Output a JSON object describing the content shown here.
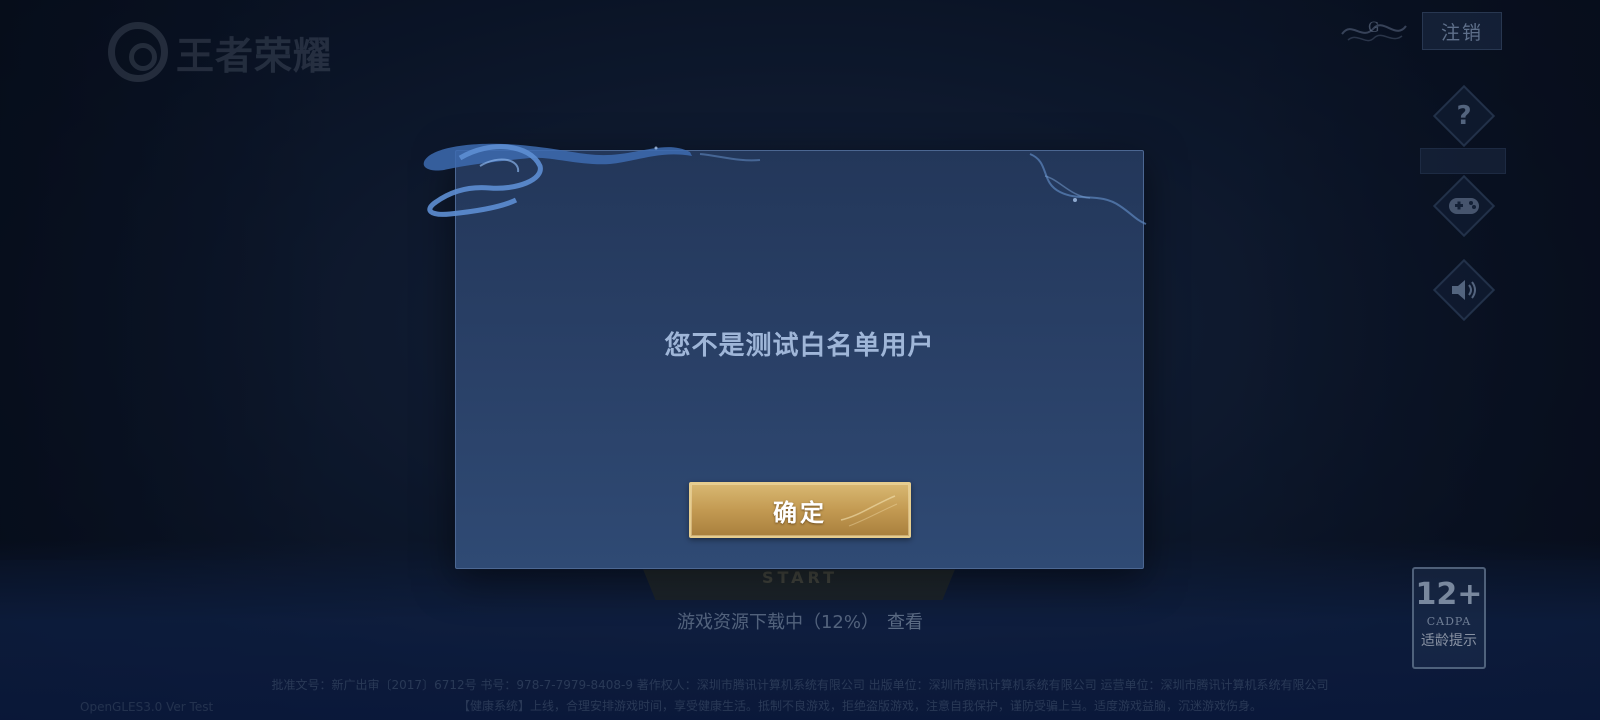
{
  "app": {
    "logo_text": "王者荣耀"
  },
  "top_right": {
    "logout_label": "注销",
    "help_icon": "question-icon",
    "gamepad_icon": "gamepad-icon",
    "sound_icon": "speaker-icon"
  },
  "dialog": {
    "message": "您不是测试白名单用户",
    "confirm_label": "确定"
  },
  "launcher": {
    "start_label": "START",
    "download_status": "游戏资源下载中（12%）",
    "download_progress_percent": 12,
    "view_link": "查看"
  },
  "age_rating": {
    "rating": "12+",
    "org": "CADPA",
    "tip": "适龄提示"
  },
  "footer": {
    "copyright_line1": "批准文号：新广出审〔2017〕6712号 书号：978-7-7979-8408-9 著作权人：深圳市腾讯计算机系统有限公司 出版单位：深圳市腾讯计算机系统有限公司 运营单位：深圳市腾讯计算机系统有限公司",
    "copyright_line2": "【健康系统】上线，合理安排游戏时间，享受健康生活。抵制不良游戏，拒绝盗版游戏，注意自我保护，谨防受骗上当。适度游戏益脑，沉迷游戏伤身。",
    "version": "OpenGLES3.0 Ver Test"
  },
  "colors": {
    "accent_gold": "#c39a52",
    "dialog_bg": "#2a4168",
    "message_text": "#9fb6d8"
  }
}
